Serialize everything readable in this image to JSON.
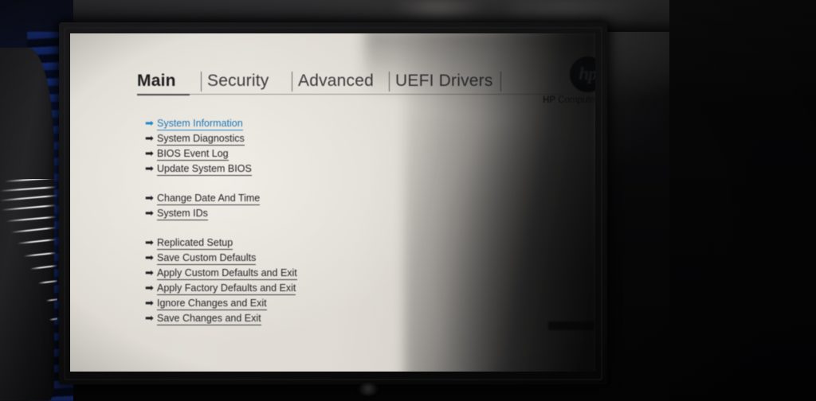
{
  "app": {
    "title": "HP Computer Setup",
    "brand_mark": "hp",
    "brand_caption_bold": "HP",
    "brand_caption_rest": " Computer Setup",
    "accent_color": "#2077b4",
    "screen_background": "#e0dcd5",
    "text_color": "#232326"
  },
  "tabs": [
    {
      "label": "Main",
      "active": true
    },
    {
      "label": "Security",
      "active": false
    },
    {
      "label": "Advanced",
      "active": false
    },
    {
      "label": "UEFI Drivers",
      "active": false
    }
  ],
  "menu": {
    "groups": [
      {
        "items": [
          {
            "label": "System Information",
            "arrow": "➡",
            "selected": true
          },
          {
            "label": "System Diagnostics",
            "arrow": "➡",
            "selected": false
          },
          {
            "label": "BIOS Event Log",
            "arrow": "➡",
            "selected": false
          },
          {
            "label": "Update System BIOS",
            "arrow": "➡",
            "selected": false
          }
        ]
      },
      {
        "items": [
          {
            "label": "Change Date And Time",
            "arrow": "➡",
            "selected": false
          },
          {
            "label": "System IDs",
            "arrow": "➡",
            "selected": false
          }
        ]
      },
      {
        "items": [
          {
            "label": "Replicated Setup",
            "arrow": "➡",
            "selected": false
          },
          {
            "label": "Save Custom Defaults",
            "arrow": "➡",
            "selected": false
          },
          {
            "label": "Apply Custom Defaults and Exit",
            "arrow": "➡",
            "selected": false
          },
          {
            "label": "Apply Factory Defaults and Exit",
            "arrow": "➡",
            "selected": false
          },
          {
            "label": "Ignore Changes and Exit",
            "arrow": "➡",
            "selected": false
          },
          {
            "label": "Save Changes and Exit",
            "arrow": "➡",
            "selected": false
          }
        ]
      }
    ]
  }
}
